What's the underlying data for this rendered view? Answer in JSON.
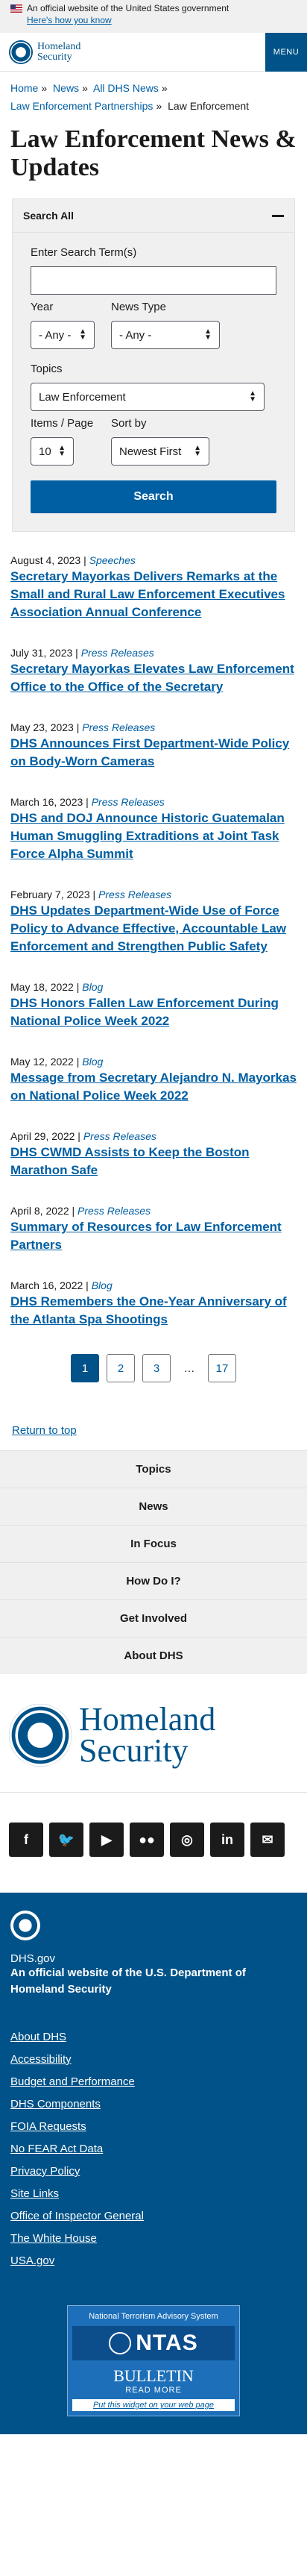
{
  "banner": {
    "text": "An official website of the United States government",
    "link": "Here's how you know"
  },
  "header": {
    "logo_line1": "Homeland",
    "logo_line2": "Security",
    "menu": "MENU"
  },
  "breadcrumb": [
    {
      "label": "Home",
      "link": true
    },
    {
      "label": "News",
      "link": true
    },
    {
      "label": "All DHS News",
      "link": true
    },
    {
      "label": "Law Enforcement Partnerships",
      "link": true
    },
    {
      "label": "Law Enforcement",
      "link": false
    }
  ],
  "page_title": "Law Enforcement News & Updates",
  "search": {
    "header": "Search All",
    "term_label": "Enter Search Term(s)",
    "year_label": "Year",
    "year_value": "- Any -",
    "type_label": "News Type",
    "type_value": "- Any -",
    "topics_label": "Topics",
    "topics_value": "Law Enforcement",
    "items_label": "Items / Page",
    "items_value": "10",
    "sort_label": "Sort by",
    "sort_value": "Newest First",
    "button": "Search"
  },
  "results": [
    {
      "date": "August 4, 2023",
      "type": "Speeches",
      "title": "Secretary Mayorkas Delivers Remarks at the Small and Rural Law Enforcement Executives Association Annual Conference"
    },
    {
      "date": "July 31, 2023",
      "type": "Press Releases",
      "title": "Secretary Mayorkas Elevates Law Enforcement Office to the Office of the Secretary"
    },
    {
      "date": "May 23, 2023",
      "type": "Press Releases",
      "title": "DHS Announces First Department-Wide Policy on Body-Worn Cameras"
    },
    {
      "date": "March 16, 2023",
      "type": "Press Releases",
      "title": "DHS and DOJ Announce Historic Guatemalan Human Smuggling Extraditions at Joint Task Force Alpha Summit"
    },
    {
      "date": "February 7, 2023",
      "type": "Press Releases",
      "title": "DHS Updates Department-Wide Use of Force Policy to Advance Effective, Accountable Law Enforcement and Strengthen Public Safety"
    },
    {
      "date": "May 18, 2022",
      "type": "Blog",
      "title": "DHS Honors Fallen Law Enforcement During National Police Week 2022"
    },
    {
      "date": "May 12, 2022",
      "type": "Blog",
      "title": "Message from Secretary Alejandro N. Mayorkas on National Police Week 2022"
    },
    {
      "date": "April 29, 2022",
      "type": "Press Releases",
      "title": "DHS CWMD Assists to Keep the Boston Marathon Safe"
    },
    {
      "date": "April 8, 2022",
      "type": "Press Releases",
      "title": "Summary of Resources for Law Enforcement Partners"
    },
    {
      "date": "March 16, 2022",
      "type": "Blog",
      "title": "DHS Remembers the One-Year Anniversary of the Atlanta Spa Shootings"
    }
  ],
  "pagination": {
    "pages": [
      "1",
      "2",
      "3"
    ],
    "ellipsis": "…",
    "last": "17",
    "current": "1"
  },
  "return_top": "Return to top",
  "footer_nav": [
    "Topics",
    "News",
    "In Focus",
    "How Do I?",
    "Get Involved",
    "About DHS"
  ],
  "footer_logo": {
    "line1": "Homeland",
    "line2": "Security"
  },
  "social": [
    {
      "icon": "facebook-icon",
      "glyph": "f"
    },
    {
      "icon": "twitter-icon",
      "glyph": "🐦"
    },
    {
      "icon": "youtube-icon",
      "glyph": "▶"
    },
    {
      "icon": "flickr-icon",
      "glyph": "●●"
    },
    {
      "icon": "instagram-icon",
      "glyph": "◎"
    },
    {
      "icon": "linkedin-icon",
      "glyph": "in"
    },
    {
      "icon": "email-icon",
      "glyph": "✉"
    }
  ],
  "bottom": {
    "site": "DHS.gov",
    "official_prefix": "An official website of the ",
    "official_link": "U.S. Department of Homeland Security",
    "links": [
      "About DHS",
      "Accessibility",
      "Budget and Performance",
      "DHS Components",
      "FOIA Requests",
      "No FEAR Act Data",
      "Privacy Policy",
      "Site Links",
      "Office of Inspector General",
      "The White House",
      "USA.gov"
    ]
  },
  "ntas": {
    "sub": "National Terrorism Advisory System",
    "word": "NTAS",
    "bulletin": "BULLETIN",
    "read_more": "READ MORE",
    "put": "Put this widget on your web page"
  },
  "colors": {
    "brand": "#005288",
    "link": "#005ea2"
  }
}
